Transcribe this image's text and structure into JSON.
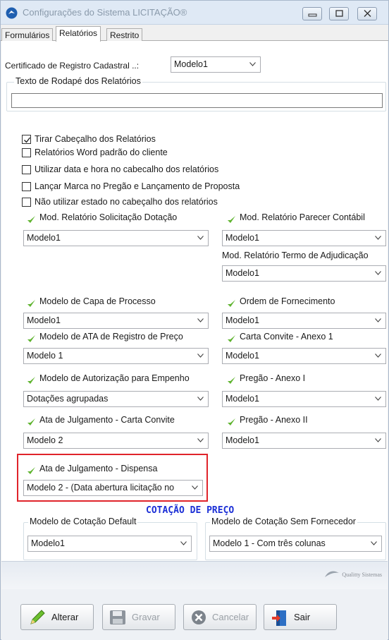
{
  "window": {
    "title": "Configurações do Sistema LICITAÇÃO®"
  },
  "tabs": [
    "Formulários",
    "Relatórios",
    "Restrito"
  ],
  "certificado": {
    "label": "Certificado de Registro Cadastral ..:",
    "value": "Modelo1"
  },
  "rodape": {
    "title": "Texto de  Rodapé dos Relatórios",
    "value": ""
  },
  "checkboxes": [
    {
      "label": "Tirar Cabeçalho dos Relatórios",
      "checked": true
    },
    {
      "label": "Relatórios Word padrão do cliente",
      "checked": false
    },
    {
      "label": "Utilizar data e hora no cabecalho dos relatórios",
      "checked": false
    },
    {
      "label": "Lançar Marca no Pregão e Lançamento de Proposta",
      "checked": false
    },
    {
      "label": "Não utilizar estado no cabeçalho dos relatórios",
      "checked": false
    }
  ],
  "fields": {
    "solicitacao_dotacao": {
      "label": "Mod. Relatório Solicitação Dotação",
      "value": "Modelo1"
    },
    "parecer_contabil": {
      "label": "Mod. Relatório Parecer Contábil",
      "value": "Modelo1"
    },
    "termo_adjudicacao": {
      "label": "Mod. Relatório Termo de Adjudicação",
      "value": "Modelo1"
    },
    "capa_processo": {
      "label": "Modelo de Capa de Processo",
      "value": "Modelo1"
    },
    "ordem_fornecimento": {
      "label": "Ordem de Fornecimento",
      "value": "Modelo1"
    },
    "ata_registro_preco": {
      "label": "Modelo de ATA de Registro de Preço",
      "value": "Modelo 1"
    },
    "carta_convite_anexo1": {
      "label": "Carta Convite - Anexo 1",
      "value": "Modelo1"
    },
    "autorizacao_empenho": {
      "label": "Modelo de Autorização para Empenho",
      "value": "Dotações agrupadas"
    },
    "pregao_anexo1": {
      "label": "Pregão - Anexo I",
      "value": "Modelo1"
    },
    "ata_carta_convite": {
      "label": "Ata de Julgamento - Carta Convite",
      "value": "Modelo 2"
    },
    "pregao_anexo2": {
      "label": "Pregão - Anexo II",
      "value": "Modelo1"
    },
    "ata_dispensa": {
      "label": "Ata de Julgamento - Dispensa",
      "value": "Modelo 2 - (Data abertura licitação no"
    }
  },
  "cotacao": {
    "section_title": "COTAÇÃO DE PREÇO",
    "default": {
      "label": "Modelo de Cotação Default",
      "value": "Modelo1"
    },
    "sem_fornecedor": {
      "label": "Modelo de Cotação Sem Fornecedor",
      "value": "Modelo 1 - Com três colunas"
    }
  },
  "branding": {
    "logo_text": "Qualitty Sistemas"
  },
  "buttons": {
    "alterar": "Alterar",
    "gravar": "Gravar",
    "cancelar": "Cancelar",
    "sair": "Sair"
  },
  "colors": {
    "accent_check": "#5fb42f",
    "section_title": "#1b2fd6",
    "highlight": "#e0242b"
  }
}
